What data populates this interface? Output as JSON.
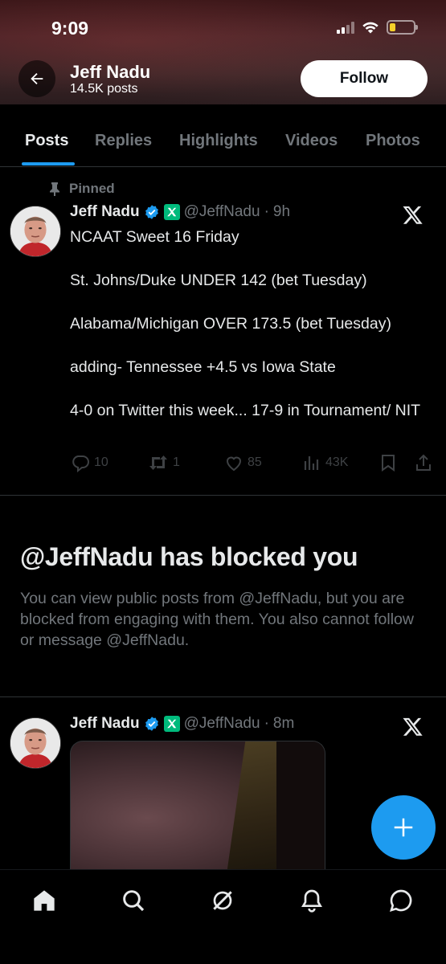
{
  "status_bar": {
    "time": "9:09",
    "battery_color": "#f5d02a",
    "battery_level": 0.25
  },
  "header": {
    "back_icon": "arrow-left-icon",
    "name": "Jeff Nadu",
    "post_count": "14.5K posts",
    "follow_label": "Follow"
  },
  "tabs": [
    "Posts",
    "Replies",
    "Highlights",
    "Videos",
    "Photos"
  ],
  "active_tab": "Posts",
  "accent_color": "#1d9bf0",
  "pinned_tweet": {
    "pinned_label": "Pinned",
    "author": "Jeff Nadu",
    "handle": "@JeffNadu",
    "separator": "·",
    "time": "9h",
    "lines": [
      "NCAAT Sweet 16 Friday",
      "St. Johns/Duke UNDER 142 (bet Tuesday)",
      "Alabama/Michigan OVER 173.5 (bet Tuesday)",
      "adding- Tennessee +4.5 vs Iowa State",
      "4-0 on Twitter this week... 17-9 in Tournament/ NIT"
    ],
    "stats": {
      "replies": "10",
      "reposts": "1",
      "likes": "85",
      "views": "43K"
    }
  },
  "blocked_notice": {
    "title": "@JeffNadu has blocked you",
    "body": "You can view public posts from @JeffNadu, but you are blocked from engaging with them. You also cannot follow or message @JeffNadu."
  },
  "second_tweet": {
    "author": "Jeff Nadu",
    "handle": "@JeffNadu",
    "separator": "·",
    "time": "8m"
  },
  "fab_icon": "plus-icon",
  "bottom_nav": [
    "home-icon",
    "search-icon",
    "grok-icon",
    "notifications-icon",
    "messages-icon"
  ]
}
